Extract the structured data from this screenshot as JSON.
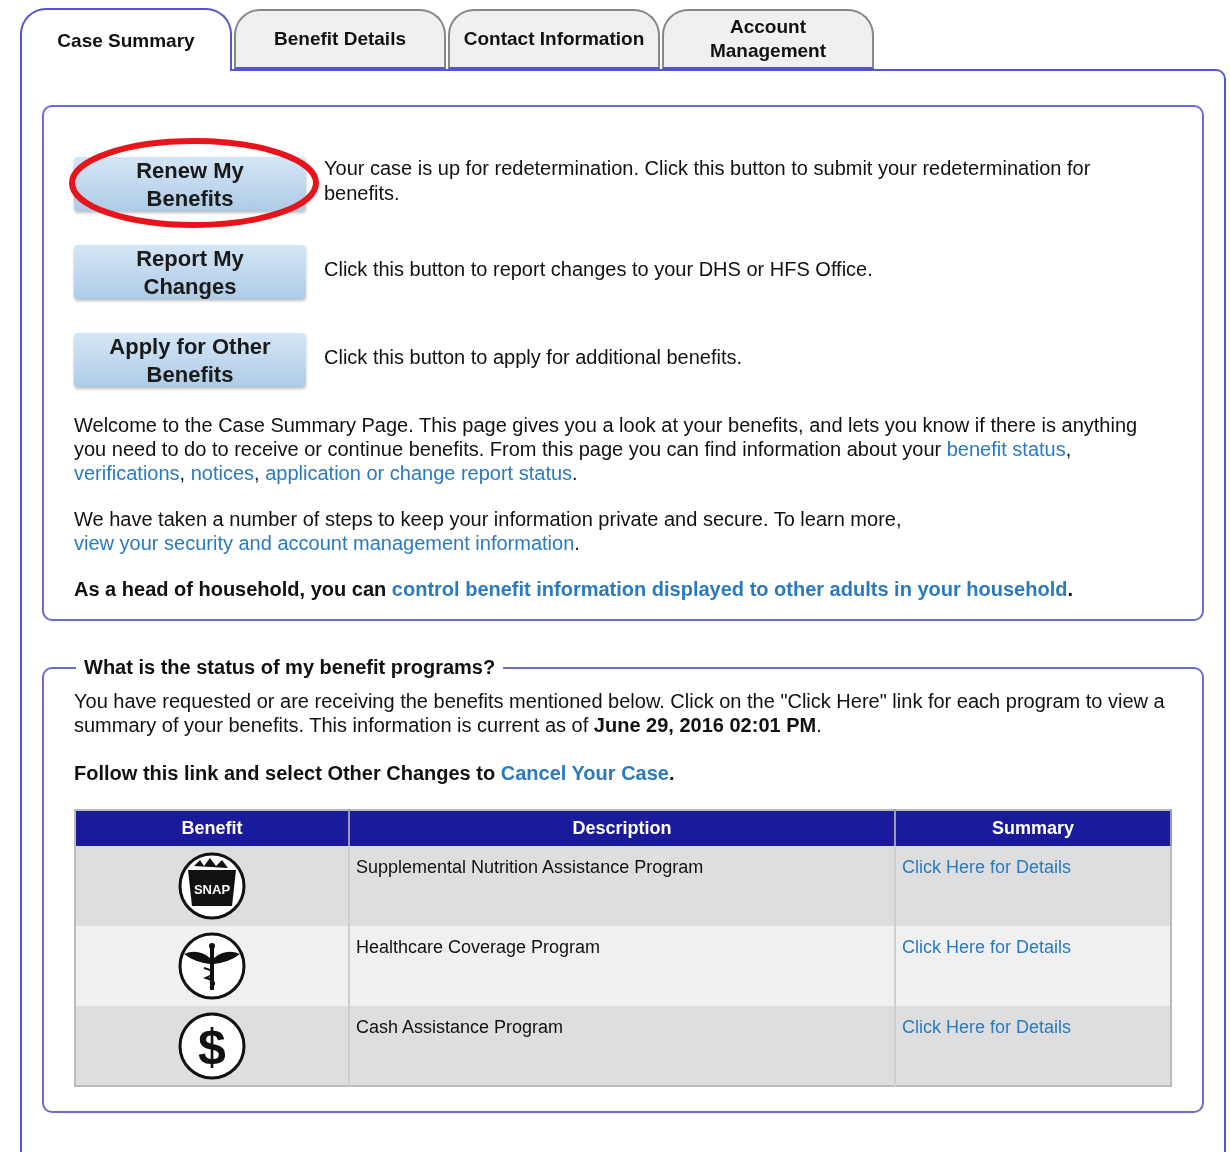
{
  "tabs": [
    {
      "label": "Case Summary",
      "selected": true
    },
    {
      "label": "Benefit Details",
      "selected": false
    },
    {
      "label": "Contact Information",
      "selected": false
    },
    {
      "label": "Account Management",
      "selected": false
    }
  ],
  "actions": [
    {
      "button": "Renew My Benefits",
      "text": "Your case is up for redetermination. Click this button to submit your redetermination for benefits.",
      "circled": true
    },
    {
      "button": "Report My Changes",
      "text": "Click this button to report changes to your DHS or HFS Office.",
      "circled": false
    },
    {
      "button": "Apply for Other Benefits",
      "text": "Click this button to apply for additional benefits.",
      "circled": false
    }
  ],
  "intro_paragraphs": [
    {
      "bold": false,
      "segments": [
        {
          "text": "Welcome to the Case Summary Page. This page gives you a look at your benefits, and lets you know if there is anything you need to do to receive or continue benefits. From this page you can find information about your ",
          "link": false
        },
        {
          "text": "benefit status",
          "link": true
        },
        {
          "text": ", ",
          "link": false
        },
        {
          "text": "verifications",
          "link": true
        },
        {
          "text": ", ",
          "link": false
        },
        {
          "text": "notices",
          "link": true
        },
        {
          "text": ", ",
          "link": false
        },
        {
          "text": "application or change report status",
          "link": true
        },
        {
          "text": ".",
          "link": false
        }
      ]
    },
    {
      "bold": false,
      "segments": [
        {
          "text": "We have taken a number of steps to keep your information private and secure. To learn more, ",
          "link": false
        },
        {
          "text": "view your security and account management information",
          "link": true
        },
        {
          "text": ".",
          "link": false
        }
      ]
    },
    {
      "bold": true,
      "segments": [
        {
          "text": "As a head of household, you can ",
          "link": false
        },
        {
          "text": "control benefit information displayed to other adults in your household",
          "link": true
        },
        {
          "text": ".",
          "link": false
        }
      ]
    }
  ],
  "status_section": {
    "legend": "What is the status of my benefit programs?",
    "paragraphs": [
      {
        "bold": false,
        "segments": [
          {
            "text": "You have requested or are receiving the benefits mentioned below. Click on the \"Click Here\" link for each program to view a summary of your benefits. This information is current as of **June 29, 2016 02:01 PM**.",
            "link": false
          }
        ]
      },
      {
        "bold": true,
        "segments": [
          {
            "text": "Follow this link and select Other Changes to ",
            "link": false
          },
          {
            "text": "Cancel Your Case",
            "link": true
          },
          {
            "text": ".",
            "link": false
          }
        ]
      }
    ],
    "table": {
      "columns": [
        "Benefit",
        "Description",
        "Summary"
      ],
      "rows": [
        {
          "kind": "snap",
          "icon_text": "SNAP",
          "description": "Supplemental Nutrition Assistance Program",
          "summary": "Click Here for Details"
        },
        {
          "kind": "caduceus",
          "description": "Healthcare Coverage Program",
          "summary": "Click Here for Details"
        },
        {
          "kind": "dollar",
          "icon_text": "$",
          "description": "Cash Assistance Program",
          "summary": "Click Here for Details"
        }
      ]
    }
  }
}
